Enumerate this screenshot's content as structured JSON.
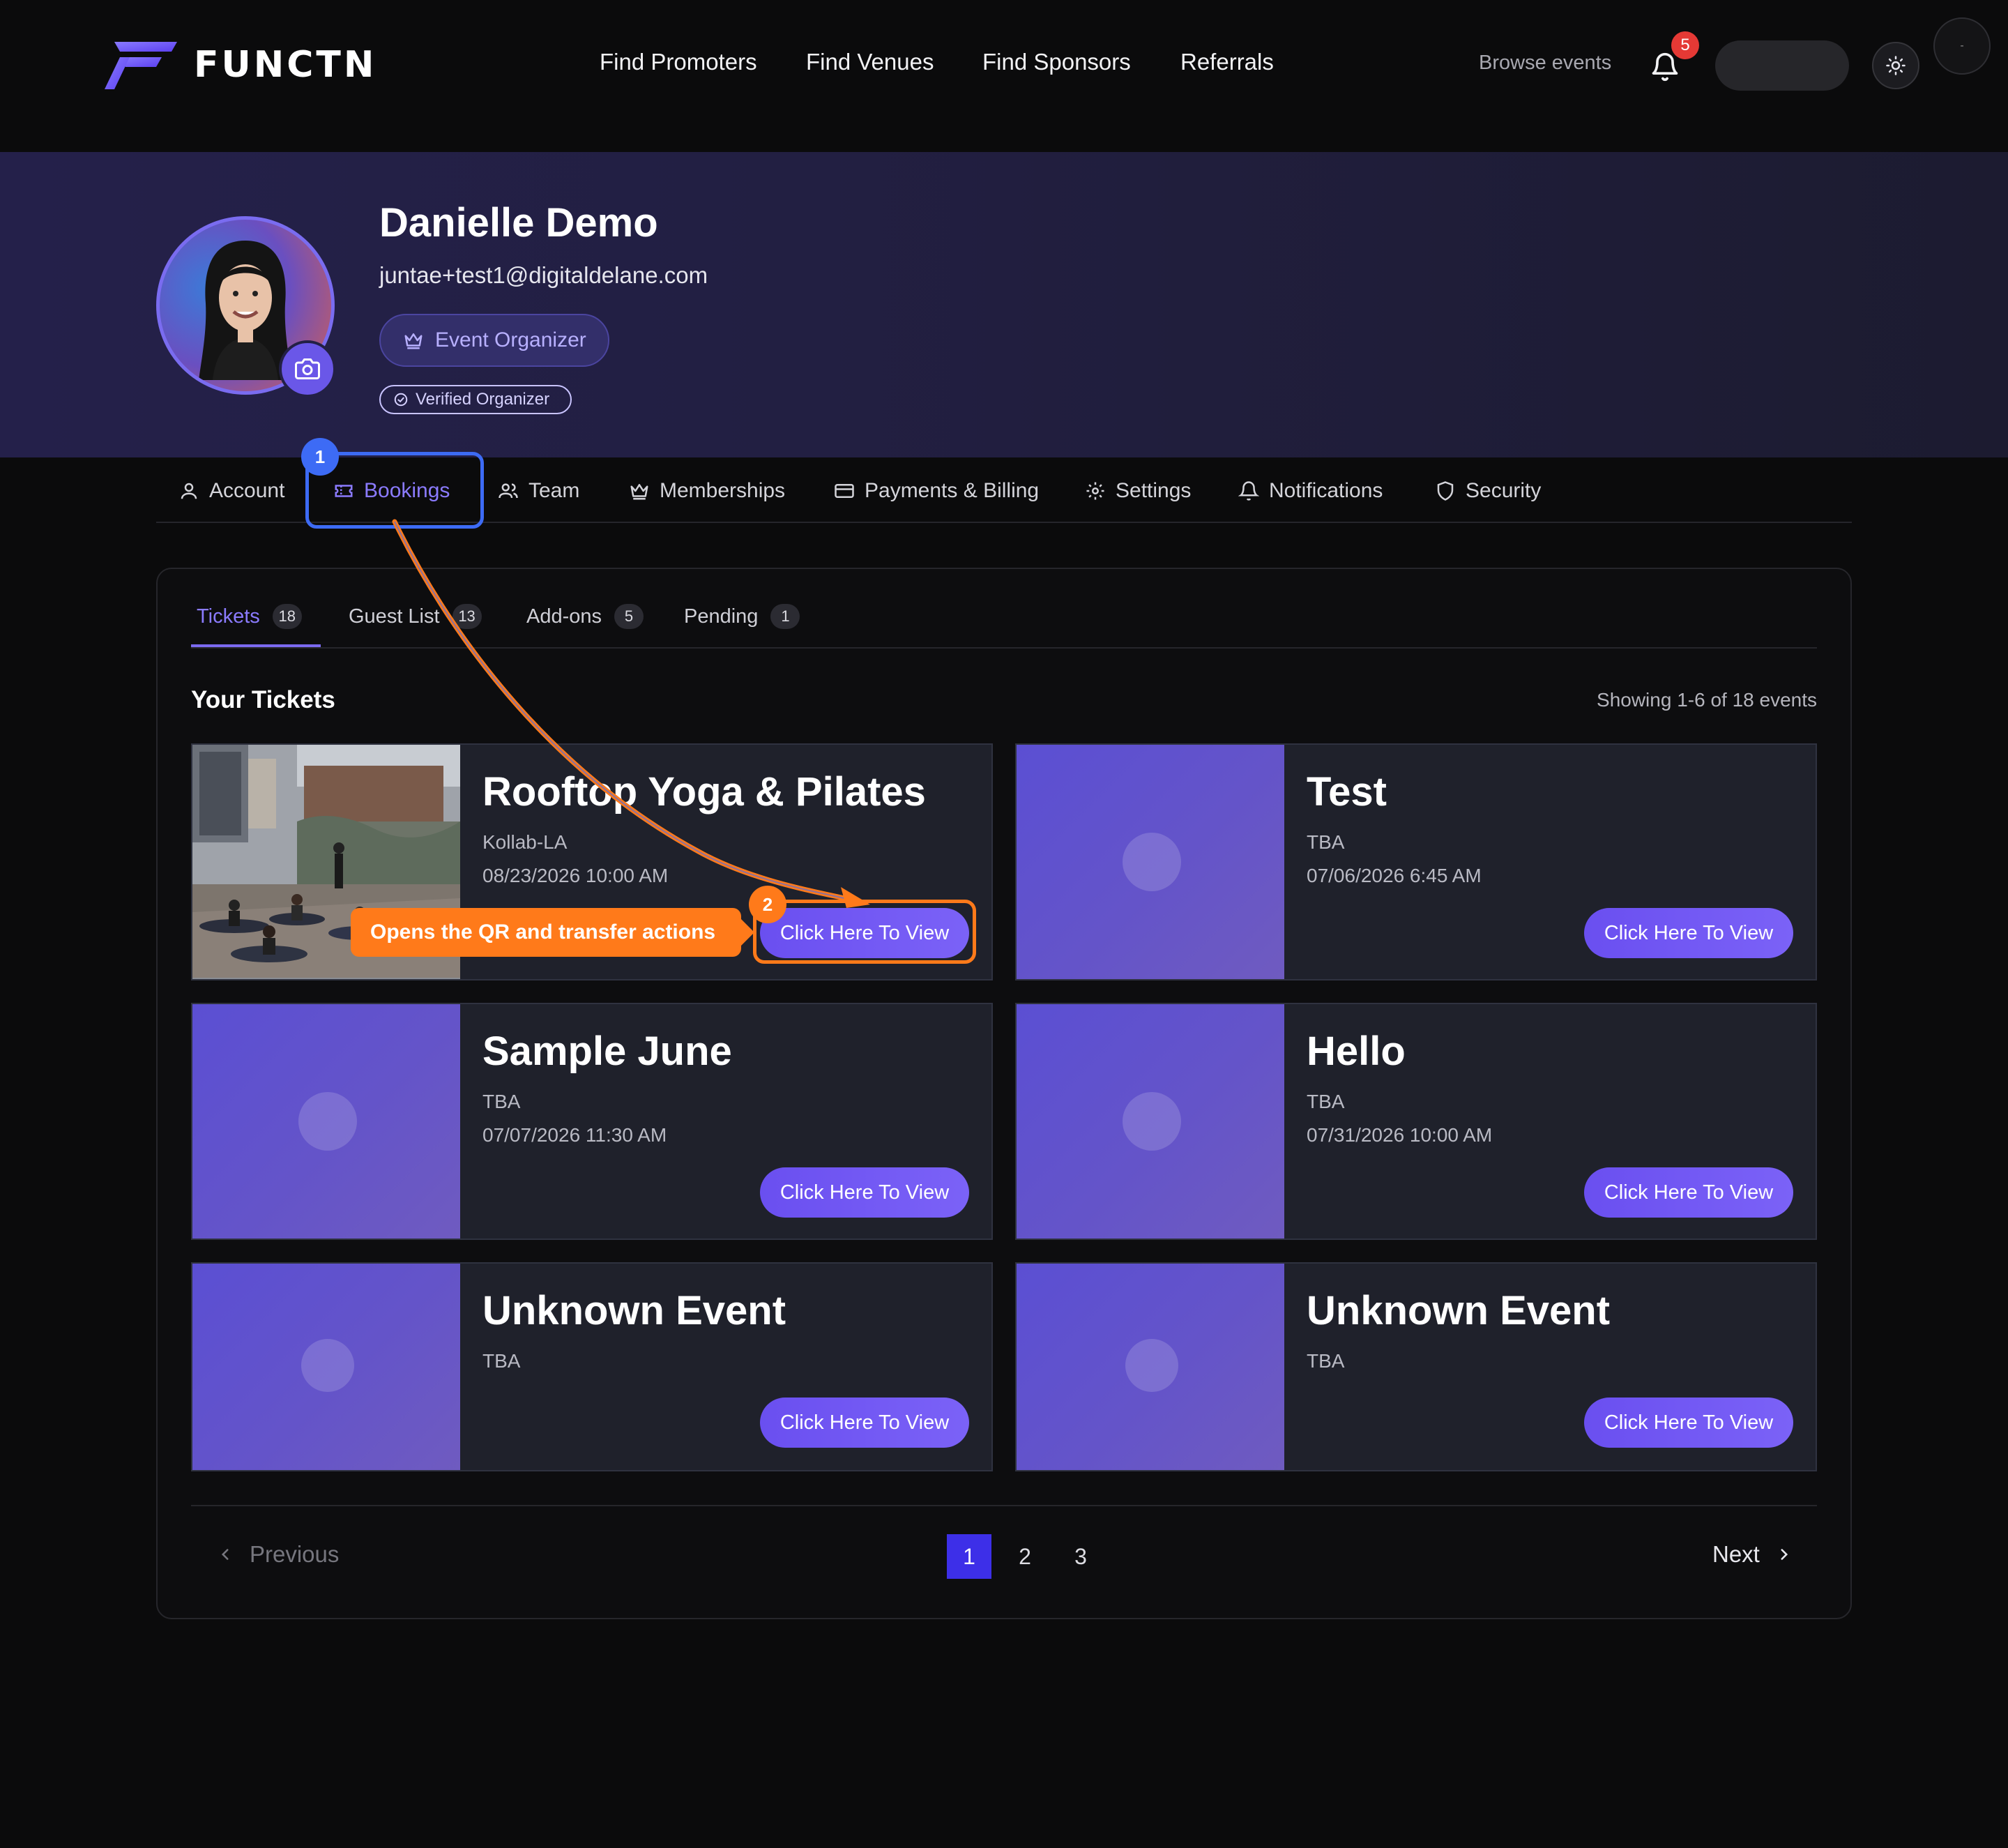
{
  "brand": {
    "name": "FUNCTN",
    "accent": "#7b6af0"
  },
  "nav": {
    "links": [
      "Find Promoters",
      "Find Venues",
      "Find Sponsors",
      "Referrals"
    ],
    "browse": "Browse events",
    "notification_count": "5",
    "corner_glyph": "-"
  },
  "profile": {
    "name": "Danielle Demo",
    "email": "juntae+test1@digitaldelane.com",
    "role": "Event Organizer",
    "verified": "Verified Organizer"
  },
  "profile_tabs": [
    "Account",
    "Bookings",
    "Team",
    "Memberships",
    "Payments & Billing",
    "Settings",
    "Notifications",
    "Security"
  ],
  "sub_tabs": [
    {
      "label": "Tickets",
      "count": "18"
    },
    {
      "label": "Guest List",
      "count": "13"
    },
    {
      "label": "Add-ons",
      "count": "5"
    },
    {
      "label": "Pending",
      "count": "1"
    }
  ],
  "tickets": {
    "title": "Your Tickets",
    "showing": "Showing 1-6 of 18 events",
    "view_label": "Click Here To View",
    "events": [
      {
        "title": "Rooftop Yoga & Pilates",
        "venue": "Kollab-LA",
        "date": "08/23/2026 10:00 AM"
      },
      {
        "title": "Test",
        "venue": "TBA",
        "date": "07/06/2026 6:45 AM"
      },
      {
        "title": "Sample June",
        "venue": "TBA",
        "date": "07/07/2026 11:30 AM"
      },
      {
        "title": "Hello",
        "venue": "TBA",
        "date": "07/31/2026 10:00 AM"
      },
      {
        "title": "Unknown Event",
        "venue": "TBA",
        "date": ""
      },
      {
        "title": "Unknown Event",
        "venue": "TBA",
        "date": ""
      }
    ]
  },
  "annotations": {
    "step1": "1",
    "step2": "2",
    "callout": "Opens the QR and transfer actions"
  },
  "pagination": {
    "previous": "Previous",
    "next": "Next",
    "pages": [
      "1",
      "2",
      "3"
    ],
    "current": "1"
  }
}
